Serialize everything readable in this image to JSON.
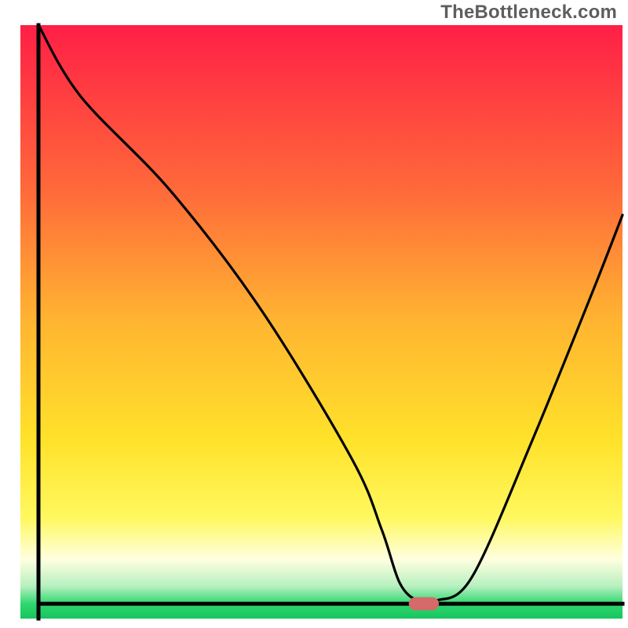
{
  "watermark": "TheBottleneck.com",
  "chart_data": {
    "type": "line",
    "title": "",
    "xlabel": "",
    "ylabel": "",
    "xlim": [
      0,
      100
    ],
    "ylim": [
      0,
      100
    ],
    "grid": false,
    "legend": false,
    "background_gradient": {
      "stops": [
        {
          "offset": 0.0,
          "color": "#ff1f46"
        },
        {
          "offset": 0.28,
          "color": "#ff6a3a"
        },
        {
          "offset": 0.5,
          "color": "#ffb531"
        },
        {
          "offset": 0.7,
          "color": "#ffe22a"
        },
        {
          "offset": 0.83,
          "color": "#fff85f"
        },
        {
          "offset": 0.9,
          "color": "#ffffe0"
        },
        {
          "offset": 0.945,
          "color": "#b8f0c0"
        },
        {
          "offset": 0.975,
          "color": "#2fd870"
        },
        {
          "offset": 1.0,
          "color": "#18c45e"
        }
      ]
    },
    "series": [
      {
        "name": "bottleneck-curve",
        "color": "#000000",
        "x": [
          3,
          10,
          25,
          40,
          55,
          60,
          63,
          66,
          69,
          75,
          85,
          95,
          100
        ],
        "values": [
          100,
          88,
          72,
          52,
          27,
          15,
          6,
          3,
          3,
          7,
          30,
          55,
          68
        ]
      }
    ],
    "marker": {
      "name": "optimal-point",
      "x": 67,
      "y": 2.5,
      "color": "#d46a6a",
      "width": 5,
      "height": 2.2,
      "rx": 1.1
    },
    "axes": {
      "left": {
        "x": 3,
        "y1": 0,
        "y2": 100,
        "color": "#000000",
        "width": 5
      },
      "bottom": {
        "y": 2.5,
        "x1": 3,
        "x2": 100,
        "color": "#000000",
        "width": 5
      }
    }
  }
}
